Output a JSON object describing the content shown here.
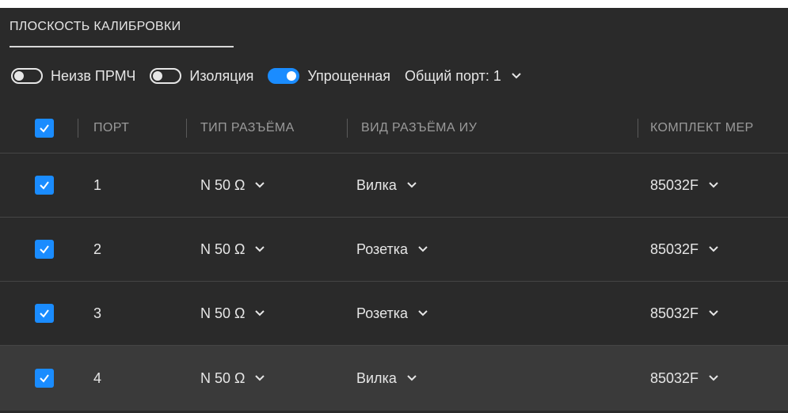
{
  "tab": {
    "title": "ПЛОСКОСТЬ КАЛИБРОВКИ"
  },
  "toggles": [
    {
      "label": "Неизв ПРМЧ",
      "on": false
    },
    {
      "label": "Изоляция",
      "on": false
    },
    {
      "label": "Упрощенная",
      "on": true
    }
  ],
  "common_port": {
    "label": "Общий порт: 1"
  },
  "table": {
    "headers": {
      "port": "ПОРТ",
      "type": "ТИП РАЗЪЁМА",
      "kind": "ВИД РАЗЪЁМА ИУ",
      "kit": "КОМПЛЕКТ МЕР"
    },
    "rows": [
      {
        "port": "1",
        "type": "N 50 Ω",
        "kind": "Вилка",
        "kit": "85032F"
      },
      {
        "port": "2",
        "type": "N 50 Ω",
        "kind": "Розетка",
        "kit": "85032F"
      },
      {
        "port": "3",
        "type": "N 50 Ω",
        "kind": "Розетка",
        "kit": "85032F"
      },
      {
        "port": "4",
        "type": "N 50 Ω",
        "kind": "Вилка",
        "kit": "85032F"
      }
    ]
  },
  "colors": {
    "accent": "#1a8cff",
    "background": "#2a2a2a",
    "selected_row": "#3a3a3a"
  }
}
